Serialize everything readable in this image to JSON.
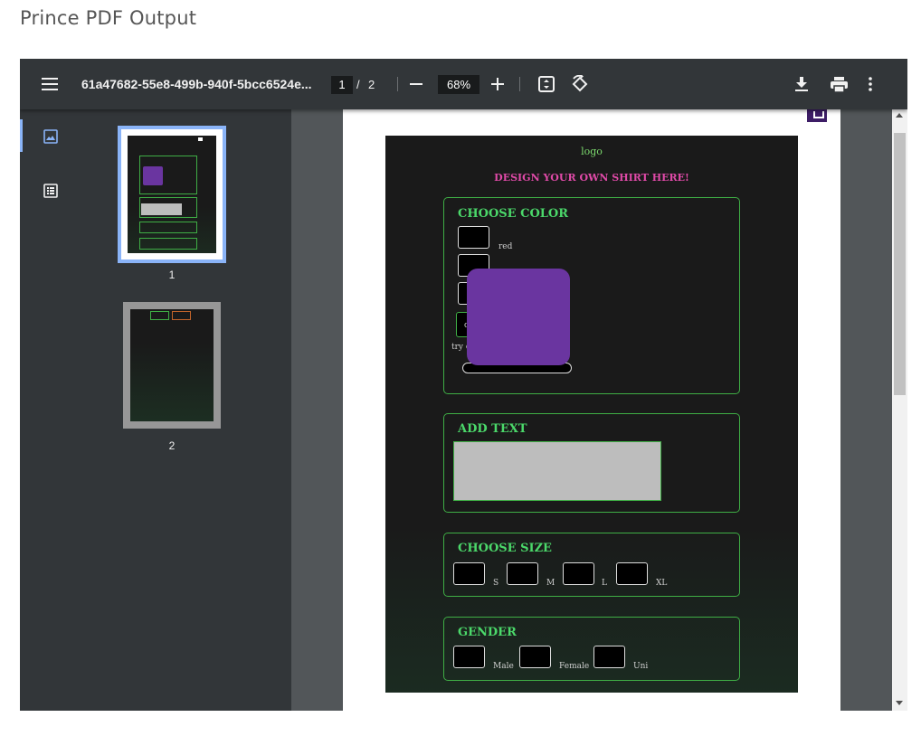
{
  "page": {
    "heading": "Prince PDF Output"
  },
  "toolbar": {
    "menu_icon": "hamburger-menu-icon",
    "doc_title": "61a47682-55e8-499b-940f-5bcc6524e...",
    "page_current": "1",
    "page_separator": "/",
    "page_total": "2",
    "zoom_out_icon": "minus-icon",
    "zoom_value": "68%",
    "zoom_in_icon": "plus-icon",
    "fit_icon": "fit-to-page-icon",
    "rotate_icon": "rotate-icon",
    "download_icon": "download-icon",
    "print_icon": "print-icon",
    "more_icon": "more-vert-icon"
  },
  "sidebar": {
    "thumbnails_icon": "image-icon",
    "outline_icon": "list-icon",
    "thumbnails": [
      {
        "label": "1",
        "selected": true
      },
      {
        "label": "2",
        "selected": false
      }
    ]
  },
  "document": {
    "logo": "logo",
    "title": "DESIGN YOUR OWN SHIRT HERE!",
    "sections": {
      "color": {
        "title": "CHOOSE COLOR",
        "swatch_label": "red",
        "partial_label_1": "c",
        "partial_label_2": "try c"
      },
      "text": {
        "title": "ADD TEXT"
      },
      "size": {
        "title": "CHOOSE SIZE",
        "options": [
          "S",
          "M",
          "L",
          "XL"
        ]
      },
      "gender": {
        "title": "GENDER",
        "options": [
          "Male",
          "Female",
          "Uni"
        ]
      }
    }
  },
  "colors": {
    "toolbar_bg": "#323639",
    "viewer_bg": "#525659",
    "accent_green": "#4bd86a",
    "title_pink": "#e04aa8",
    "purple": "#6a35a0",
    "thumb_selected": "#8ab4f8"
  }
}
